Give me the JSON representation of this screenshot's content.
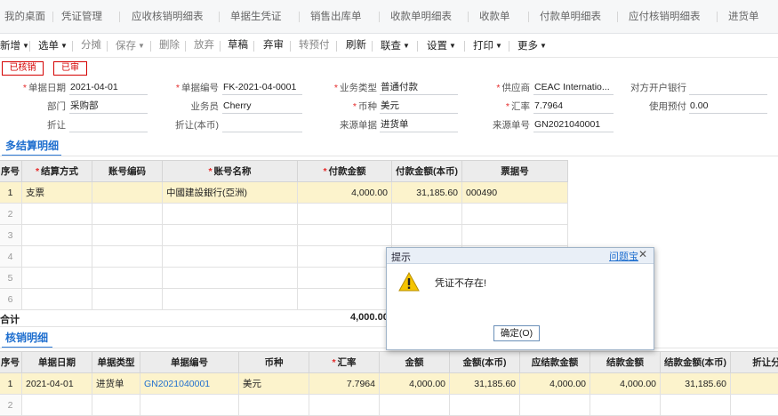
{
  "tabs": [
    "我的桌面",
    "凭证管理",
    "应收核销明细表",
    "单据生凭证",
    "销售出库单",
    "收款单明细表",
    "收款单",
    "付款单明细表",
    "应付核销明细表",
    "进货单"
  ],
  "toolbar": {
    "add": "新增",
    "select": "选单",
    "split": "分摊",
    "save": "保存",
    "delete": "删除",
    "discard": "放弃",
    "draft": "草稿",
    "abandon": "弃审",
    "prepay": "转预付",
    "refresh": "刷新",
    "audit": "联查",
    "settings": "设置",
    "print": "打印",
    "more": "更多"
  },
  "stamps": {
    "verified": "已核销",
    "audited": "已审"
  },
  "form": {
    "date_label": "单据日期",
    "date": "2021-04-01",
    "code_label": "单据编号",
    "code": "FK-2021-04-0001",
    "biztype_label": "业务类型",
    "biztype": "普通付款",
    "supplier_label": "供应商",
    "supplier": "CEAC Internatio...",
    "bank_label": "对方开户银行",
    "bank": "",
    "dept_label": "部门",
    "dept": "采购部",
    "staff_label": "业务员",
    "staff": "Cherry",
    "currency_label": "币种",
    "currency": "美元",
    "rate_label": "汇率",
    "rate": "7.7964",
    "prepay_label": "使用预付",
    "prepay": "0.00",
    "discount_label": "折让",
    "discount": "",
    "discount_base_label": "折让(本币)",
    "discount_base": "",
    "src_label": "来源单据",
    "src": "进货单",
    "src_no_label": "来源单号",
    "src_no": "GN2021040001"
  },
  "settle": {
    "title": "多结算明细",
    "headers": [
      "序号",
      "结算方式",
      "账号编码",
      "账号名称",
      "付款金额",
      "付款金额(本币)",
      "票据号"
    ],
    "rows": [
      [
        "1",
        "支票",
        "",
        "中國建設銀行(亞洲)",
        "4,000.00",
        "31,185.60",
        "000490"
      ],
      [
        "2",
        "",
        "",
        "",
        "",
        "",
        ""
      ],
      [
        "3",
        "",
        "",
        "",
        "",
        "",
        ""
      ],
      [
        "4",
        "",
        "",
        "",
        "",
        "",
        ""
      ],
      [
        "5",
        "",
        "",
        "",
        "",
        "",
        ""
      ],
      [
        "6",
        "",
        "",
        "",
        "",
        "",
        ""
      ]
    ],
    "total_label": "合计",
    "total": "4,000.00"
  },
  "verify": {
    "title": "核销明细",
    "headers": [
      "序号",
      "单据日期",
      "单据类型",
      "单据编号",
      "币种",
      "汇率",
      "金额",
      "金额(本币)",
      "应结款金额",
      "结款金额",
      "结款金额(本币)",
      "折让分"
    ],
    "rows": [
      [
        "1",
        "2021-04-01",
        "进货单",
        "GN2021040001",
        "美元",
        "7.7964",
        "4,000.00",
        "31,185.60",
        "4,000.00",
        "4,000.00",
        "31,185.60",
        ""
      ],
      [
        "2",
        "",
        "",
        "",
        "",
        "",
        "",
        "",
        "",
        "",
        "",
        ""
      ]
    ]
  },
  "dialog": {
    "title": "提示",
    "help": "问题宝",
    "close": "✕",
    "message": "凭证不存在!",
    "ok": "确定(O)"
  }
}
